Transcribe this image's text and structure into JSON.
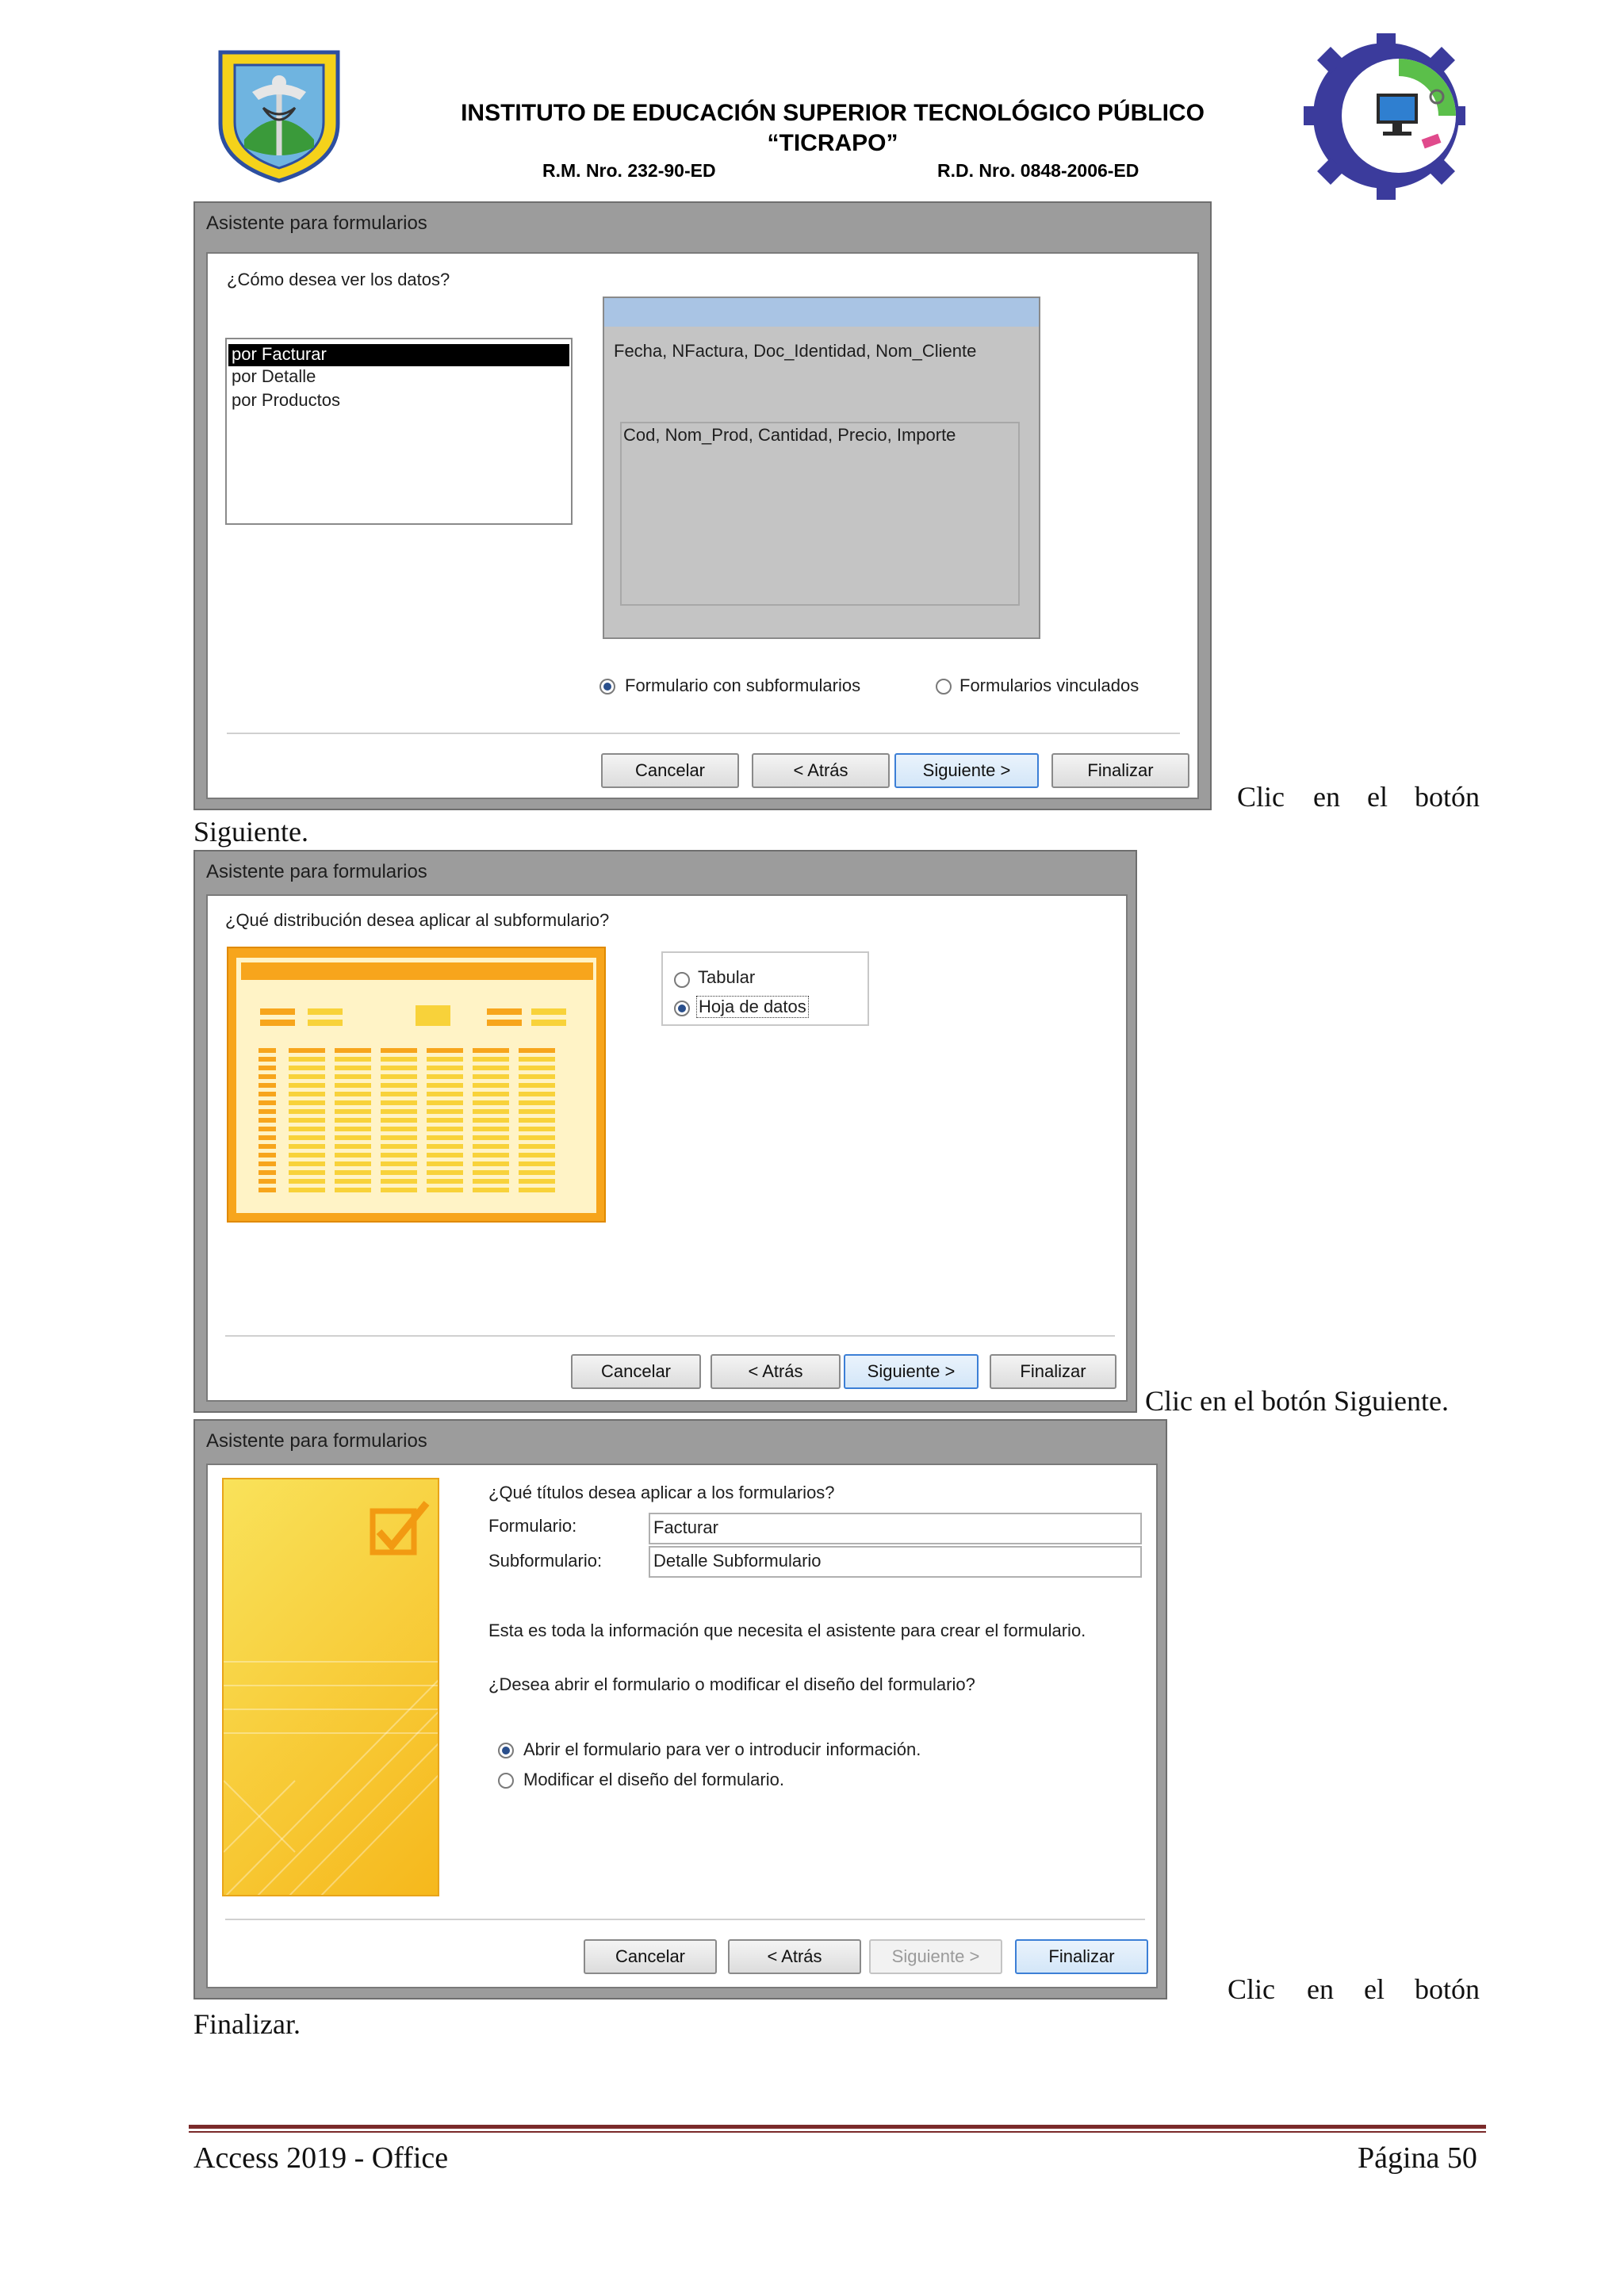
{
  "header": {
    "institute": "INSTITUTO DE EDUCACIÓN SUPERIOR TECNOLÓGICO PÚBLICO",
    "name": "“TICRAPO”",
    "rm": "R.M. Nro. 232-90-ED",
    "rd": "R.D. Nro. 0848-2006-ED",
    "left_logo": "school-crest-logo",
    "right_logo": "computing-gear-logo"
  },
  "dialog1": {
    "title": "Asistente para formularios",
    "question": "¿Cómo desea ver los datos?",
    "list_items": [
      "por Facturar",
      "por Detalle",
      "por Productos"
    ],
    "selected_index": 0,
    "preview_fields_main": "Fecha, NFactura, Doc_Identidad, Nom_Cliente",
    "preview_fields_sub": "Cod, Nom_Prod, Cantidad, Precio, Importe",
    "option_subforms": "Formulario con subformularios",
    "option_linked": "Formularios vinculados",
    "selected_option": "subforms",
    "buttons": {
      "cancel": "Cancelar",
      "back": "< Atrás",
      "next": "Siguiente >",
      "finish": "Finalizar"
    }
  },
  "caption1": {
    "line1": [
      "Clic",
      "en",
      "el",
      "botón"
    ],
    "line2": "Siguiente."
  },
  "dialog2": {
    "title": "Asistente para formularios",
    "question": "¿Qué distribución desea aplicar al subformulario?",
    "option_tabular": "Tabular",
    "option_datasheet": "Hoja de datos",
    "selected_option": "datasheet",
    "buttons": {
      "cancel": "Cancelar",
      "back": "< Atrás",
      "next": "Siguiente >",
      "finish": "Finalizar"
    }
  },
  "caption2": "Clic en el botón Siguiente.",
  "dialog3": {
    "title": "Asistente para formularios",
    "question": "¿Qué títulos desea aplicar a los formularios?",
    "form_label": "Formulario:",
    "form_value": "Facturar",
    "subform_label": "Subformulario:",
    "subform_value": "Detalle Subformulario",
    "info": "Esta es toda la información que necesita el asistente para crear el formulario.",
    "question2": "¿Desea abrir el formulario o modificar el diseño del formulario?",
    "option_open": "Abrir el formulario para ver o introducir información.",
    "option_modify": "Modificar el diseño del formulario.",
    "selected_option": "open",
    "buttons": {
      "cancel": "Cancelar",
      "back": "< Atrás",
      "next": "Siguiente >",
      "finish": "Finalizar"
    }
  },
  "caption3": {
    "line1": [
      "Clic",
      "en",
      "el",
      "botón"
    ],
    "line2": "Finalizar."
  },
  "footer": {
    "left": "Access 2019 - Office",
    "right": "Página 50"
  },
  "colors": {
    "accent_orange": "#f7a51c",
    "accent_yellow": "#f8d23a",
    "footer_rule": "#7a2a2a",
    "focus_blue": "#3c7fd6"
  }
}
